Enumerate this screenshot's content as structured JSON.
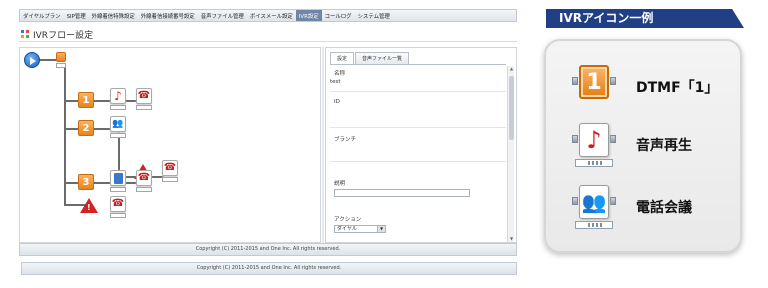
{
  "menu": {
    "items": [
      "ダイヤルプラン",
      "SIP管理",
      "外線着信特殊設定",
      "外線着信接続番号設定",
      "音声ファイル管理",
      "ボイスメール設定",
      "IVR設定",
      "コールログ",
      "システム管理"
    ],
    "active_index": 6
  },
  "page": {
    "title": "IVRフロー設定"
  },
  "flow": {
    "nodes": [
      {
        "icon": "play-icon"
      },
      {
        "icon": "dtmf-tile-icon",
        "label": "1"
      },
      {
        "icon": "dtmf-tile-icon",
        "label": "2"
      },
      {
        "icon": "dtmf-tile-icon",
        "label": "3"
      },
      {
        "icon": "music-note-icon"
      },
      {
        "icon": "phone-icon"
      },
      {
        "icon": "conference-icon"
      },
      {
        "icon": "warning-icon"
      },
      {
        "icon": "warning-icon"
      }
    ]
  },
  "props": {
    "tabs": [
      "設定",
      "音声ファイル一覧"
    ],
    "active_tab": 0,
    "fields": {
      "name_label": "名称",
      "name_value": "test",
      "id_label": "ID",
      "branch_label": "ブランチ",
      "desc_label": "説明",
      "action_label": "アクション",
      "action_value": "ダイヤル"
    }
  },
  "footer": {
    "copyright": "Copyright (C) 2011-2015 and One Inc. All rights reserved."
  },
  "legend": {
    "title": "IVRアイコン一例",
    "items": [
      {
        "icon": "dtmf-tile-icon",
        "tile_text": "1",
        "label": "DTMF「1」"
      },
      {
        "icon": "music-note-icon",
        "label": "音声再生"
      },
      {
        "icon": "conference-icon",
        "label": "電話会議"
      }
    ],
    "colors": {
      "header_bg": "#213f84",
      "tile_orange": "#e8841a",
      "note_red": "#d21a1a"
    }
  }
}
